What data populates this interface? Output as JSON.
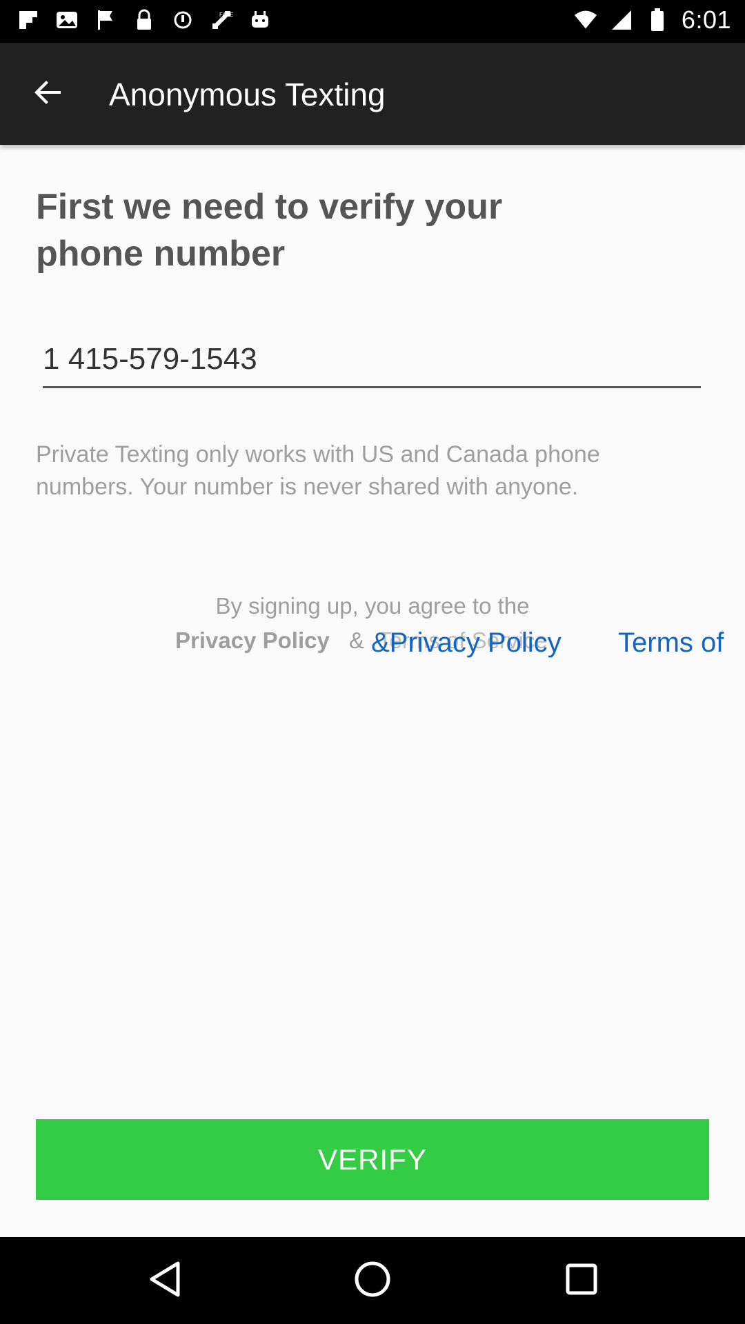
{
  "status_bar": {
    "time": "6:01",
    "left_icons": [
      "flipboard-icon",
      "image-icon",
      "flag-icon",
      "lock-icon",
      "sync-icon",
      "fake-gps-icon",
      "android-icon"
    ],
    "right_icons": [
      "wifi-icon",
      "signal-icon",
      "battery-icon"
    ]
  },
  "app_bar": {
    "title": "Anonymous Texting",
    "back_icon": "arrow-back-icon"
  },
  "main": {
    "heading": "First we need to verify your phone number",
    "phone_value": "1 415-579-1543",
    "note": "Private Texting only works with US and Canada phone numbers. Your number is never shared with anyone.",
    "agree_text": "By signing up, you agree to the",
    "privacy_policy_gray": "Privacy Policy",
    "amp": "&",
    "terms_gray": "Terms of Service",
    "privacy_policy_link": "&Privacy Policy",
    "terms_link": "Terms of"
  },
  "verify_button": "VERIFY",
  "nav_bar": {
    "icons": [
      "back-triangle-icon",
      "home-circle-icon",
      "recents-square-icon"
    ]
  },
  "colors": {
    "app_bar": "#212121",
    "verify": "#33cc44",
    "link": "#1565c0"
  }
}
